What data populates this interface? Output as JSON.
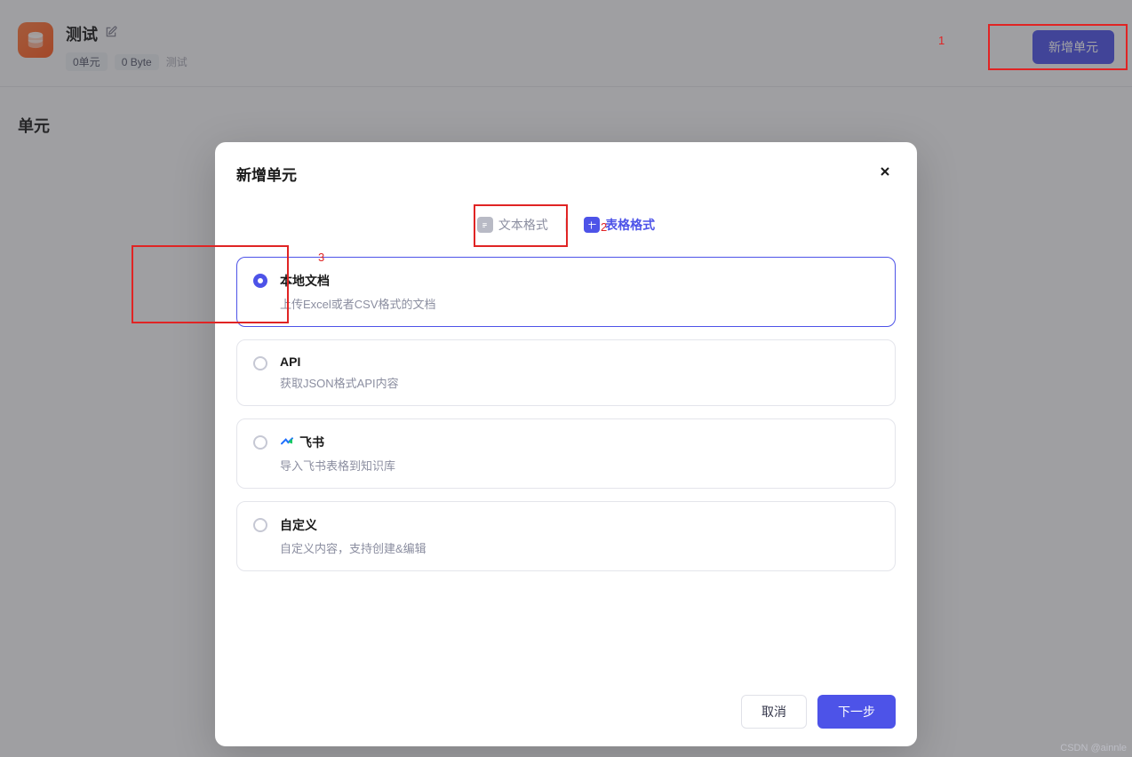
{
  "header": {
    "title": "测试",
    "stat_units": "0单元",
    "stat_size": "0 Byte",
    "stat_desc": "测试",
    "add_button": "新增单元"
  },
  "section": {
    "title": "单元"
  },
  "modal": {
    "title": "新增单元",
    "tabs": {
      "text": "文本格式",
      "table": "表格格式"
    },
    "options": [
      {
        "title": "本地文档",
        "desc": "上传Excel或者CSV格式的文档",
        "selected": true
      },
      {
        "title": "API",
        "desc": "获取JSON格式API内容",
        "selected": false
      },
      {
        "title": "飞书",
        "desc": "导入飞书表格到知识库",
        "selected": false,
        "icon": "feishu"
      },
      {
        "title": "自定义",
        "desc": "自定义内容，支持创建&编辑",
        "selected": false
      }
    ],
    "cancel": "取消",
    "next": "下一步"
  },
  "annotations": {
    "a1": "1",
    "a2": "2",
    "a3": "3"
  },
  "watermark": "CSDN @ainnle"
}
